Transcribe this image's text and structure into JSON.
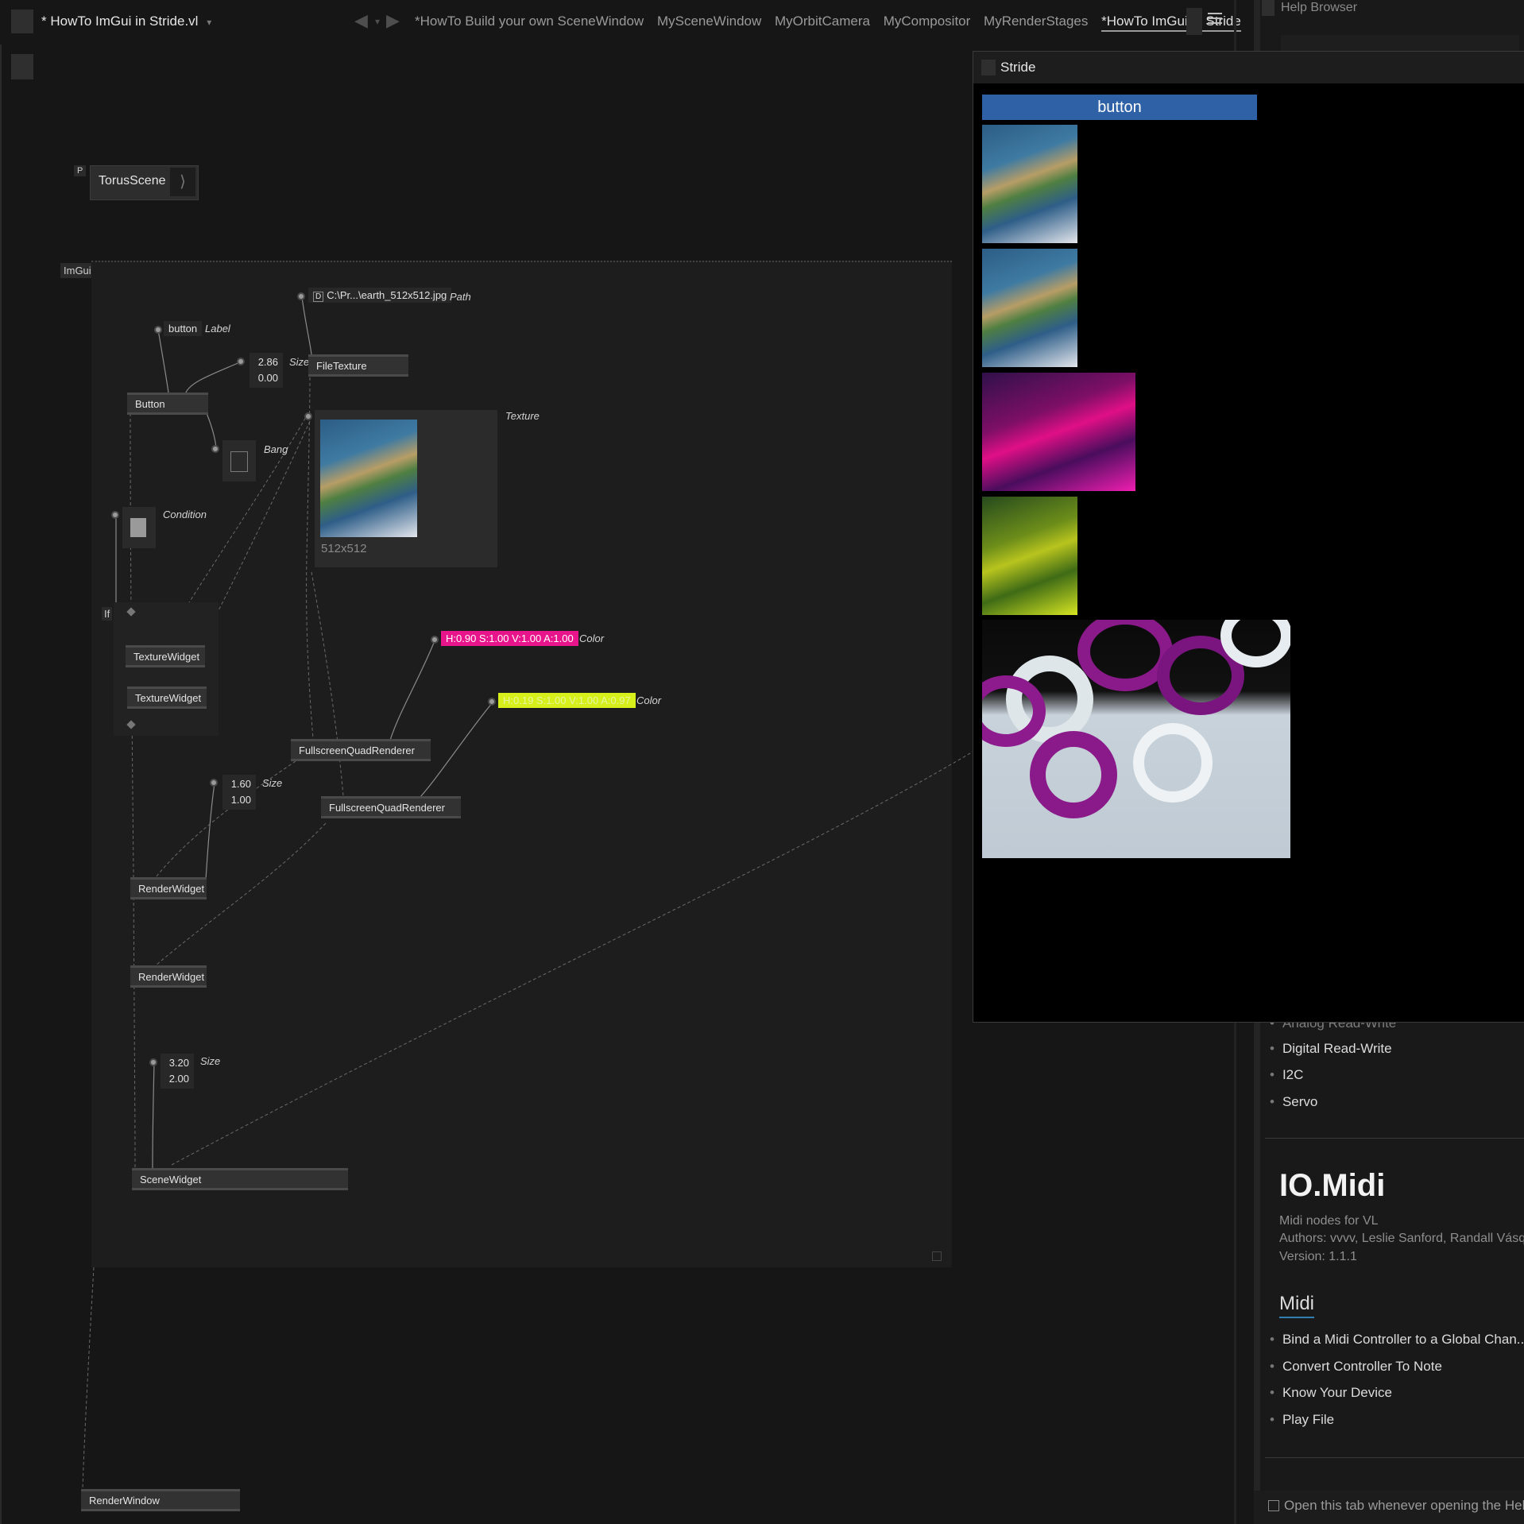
{
  "topbar": {
    "doc_title": "* HowTo ImGui in Stride.vl",
    "tabs": [
      "*HowTo Build your own SceneWindow",
      "MySceneWindow",
      "MyOrbitCamera",
      "MyCompositor",
      "MyRenderStages",
      "*HowTo ImGui in Stride"
    ]
  },
  "patch": {
    "region_label": "ImGui",
    "torus_node": "TorusScene",
    "p_badge": "P",
    "path_value": "C:\\Pr...\\earth_512x512.jpg",
    "path_label": "Path",
    "label_value": "button",
    "label_label": "Label",
    "size1": [
      "2.86",
      "0.00"
    ],
    "size_label": "Size",
    "nodes": {
      "button": "Button",
      "filetexture": "FileTexture",
      "texture1": "TextureWidget",
      "texture2": "TextureWidget",
      "fsq1": "FullscreenQuadRenderer",
      "fsq2": "FullscreenQuadRenderer",
      "render1": "RenderWidget",
      "render2": "RenderWidget",
      "scene": "SceneWidget",
      "window": "RenderWindow",
      "if": "If"
    },
    "bang_label": "Bang",
    "condition_label": "Condition",
    "texture_label": "Texture",
    "texture_size": "512x512",
    "color1": "H:0.90 S:1.00 V:1.00 A:1.00",
    "color2": "H:0.19 S:1.00 V:1.00 A:0.97",
    "color_label": "Color",
    "size2": [
      "1.60",
      "1.00"
    ],
    "size3": [
      "3.20",
      "2.00"
    ]
  },
  "stride": {
    "title": "Stride",
    "button_label": "button"
  },
  "help": {
    "title": "Help Browser",
    "io_items": [
      "Analog Read-Write",
      "Digital Read-Write",
      "I2C",
      "Servo"
    ],
    "midi_title": "IO.Midi",
    "midi_desc": "Midi nodes for VL",
    "midi_authors": "Authors: vvvv, Leslie Sanford, Randall Vásqu",
    "midi_version": "Version: 1.1.1",
    "midi_section": "Midi",
    "midi_items": [
      "Bind a Midi Controller to a Global Chan...",
      "Convert Controller To Note",
      "Know Your Device",
      "Play File"
    ],
    "footer": "Open this tab whenever opening the Helpl"
  },
  "colors": {
    "accent_blue": "#2f61a6",
    "magenta": "#e8148c",
    "yellow": "#d7f01b"
  }
}
